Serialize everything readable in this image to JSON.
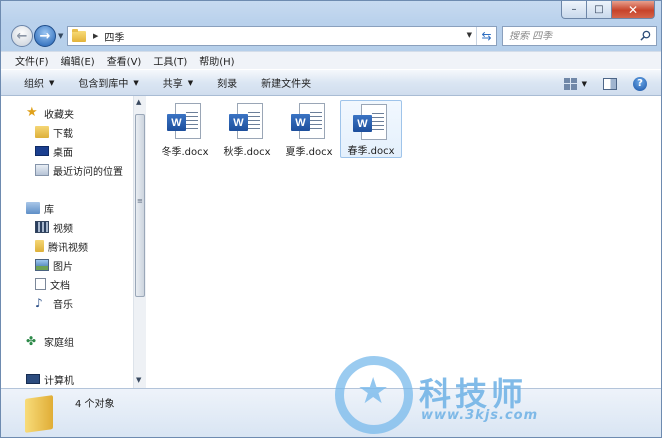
{
  "window": {
    "controls": {
      "minimize": "–",
      "maximize": "□",
      "close": "✕"
    }
  },
  "address_bar": {
    "current_folder": "四季"
  },
  "search": {
    "placeholder": "搜索 四季"
  },
  "menu": {
    "items": [
      "文件(F)",
      "编辑(E)",
      "查看(V)",
      "工具(T)",
      "帮助(H)"
    ]
  },
  "toolbar": {
    "organize": "组织",
    "include_in_library": "包含到库中",
    "share": "共享",
    "burn": "刻录",
    "new_folder": "新建文件夹",
    "help": "?"
  },
  "nav_pane": {
    "favorites": "收藏夹",
    "downloads": "下载",
    "desktop": "桌面",
    "recent_places": "最近访问的位置",
    "libraries": "库",
    "videos": "视频",
    "tencent_video": "腾讯视频",
    "pictures": "图片",
    "documents": "文档",
    "music": "音乐",
    "homegroup": "家庭组",
    "computer": "计算机"
  },
  "files": [
    {
      "name": "冬季.docx",
      "icon": "word-document-icon",
      "selected": false
    },
    {
      "name": "秋季.docx",
      "icon": "word-document-icon",
      "selected": false
    },
    {
      "name": "夏季.docx",
      "icon": "word-document-icon",
      "selected": false
    },
    {
      "name": "春季.docx",
      "icon": "word-document-icon",
      "selected": true
    }
  ],
  "details_pane": {
    "item_count": "4 个对象"
  },
  "watermark": {
    "title": "科技师",
    "url": "www.3kjs.com"
  },
  "colors": {
    "frame": "#b9d1ec",
    "selection": "#e4f0fc",
    "word_blue": "#2a5fae",
    "close_red": "#c7432a"
  }
}
